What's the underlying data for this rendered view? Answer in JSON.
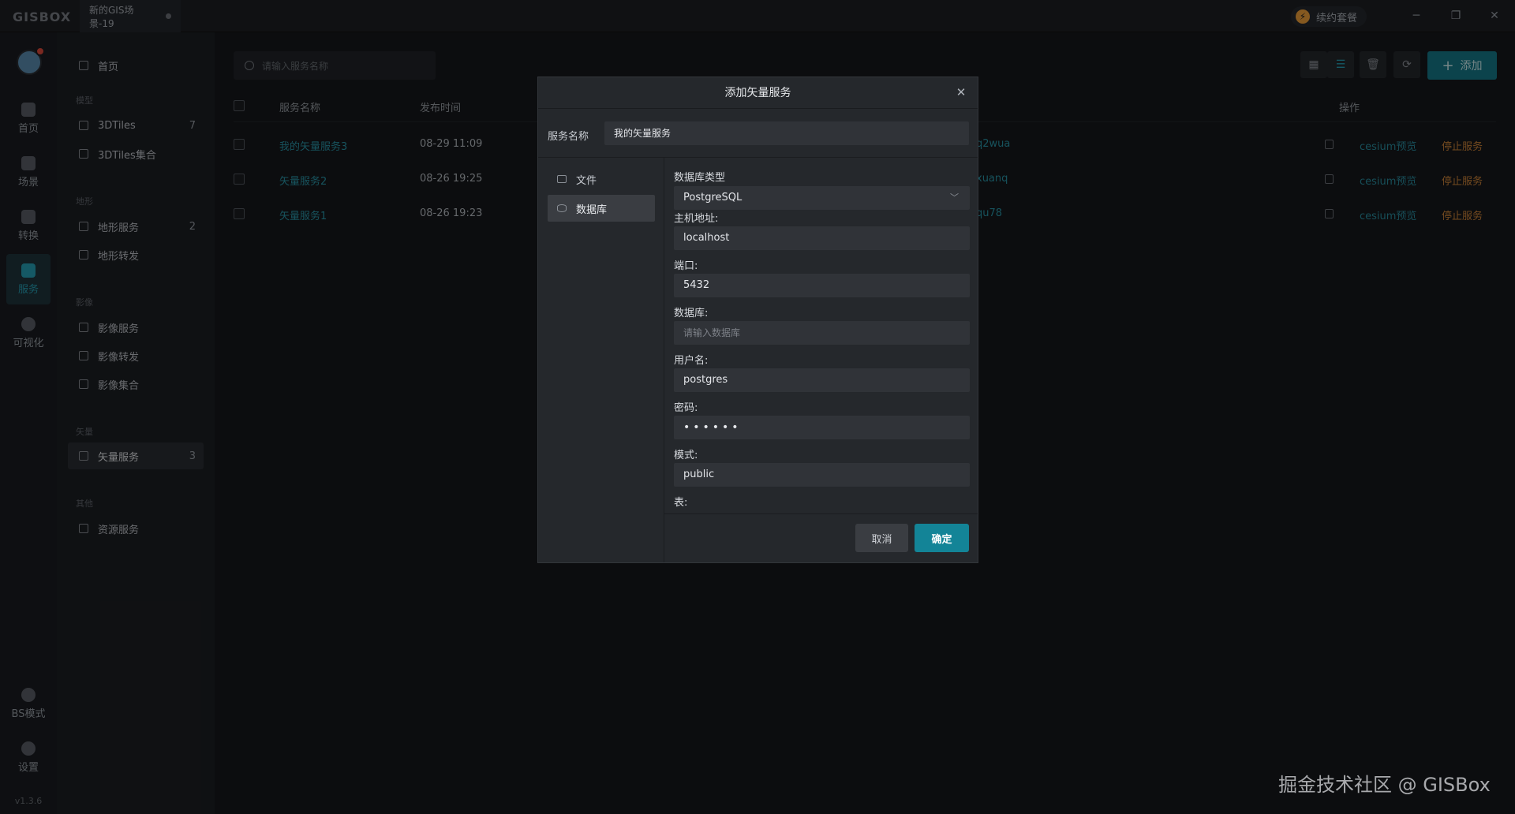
{
  "titlebar": {
    "logo": "GISBOX",
    "doc_tab": "新的GIS场景-19",
    "renew_label": "续约套餐",
    "minimize": "─",
    "restore": "❐",
    "close": "✕"
  },
  "iconbar": {
    "items": [
      {
        "label": "首页"
      },
      {
        "label": "场景"
      },
      {
        "label": "转换"
      },
      {
        "label": "服务"
      },
      {
        "label": "可视化"
      },
      {
        "label": "BS模式"
      },
      {
        "label": "设置"
      }
    ],
    "version": "v1.3.6"
  },
  "sidebar": {
    "home": "首页",
    "groups": {
      "model": "模型",
      "terrain": "地形",
      "imagery": "影像",
      "vector": "矢量",
      "other": "其他"
    },
    "items": {
      "tiles": {
        "label": "3DTiles",
        "count": "7"
      },
      "tiles_set": {
        "label": "3DTiles集合"
      },
      "terrain_service": {
        "label": "地形服务",
        "count": "2"
      },
      "terrain_forward": {
        "label": "地形转发"
      },
      "imagery_service": {
        "label": "影像服务"
      },
      "imagery_forward": {
        "label": "影像转发"
      },
      "imagery_set": {
        "label": "影像集合"
      },
      "vector_service": {
        "label": "矢量服务",
        "count": "3"
      },
      "resource_service": {
        "label": "资源服务"
      }
    }
  },
  "main": {
    "search_placeholder": "请输入服务名称",
    "add_label": "添加",
    "table": {
      "headers": {
        "name": "服务名称",
        "time": "发布时间",
        "ops": "操作"
      },
      "rows": [
        {
          "name": "我的矢量服务3",
          "time": "08-29 11:09",
          "url_tail": "q2wua",
          "preview": "cesium预览",
          "stop": "停止服务"
        },
        {
          "name": "矢量服务2",
          "time": "08-26 19:25",
          "url_tail": "xuanq",
          "preview": "cesium预览",
          "stop": "停止服务"
        },
        {
          "name": "矢量服务1",
          "time": "08-26 19:23",
          "url_tail": "qu78",
          "preview": "cesium预览",
          "stop": "停止服务"
        }
      ]
    }
  },
  "dialog": {
    "title": "添加矢量服务",
    "service_name_label": "服务名称",
    "service_name_value": "我的矢量服务",
    "sources": [
      {
        "label": "文件"
      },
      {
        "label": "数据库"
      }
    ],
    "form": {
      "db_type_label": "数据库类型",
      "db_type_value": "PostgreSQL",
      "host_label": "主机地址:",
      "host_value": "localhost",
      "port_label": "端口:",
      "port_value": "5432",
      "database_label": "数据库:",
      "database_placeholder": "请输入数据库",
      "user_label": "用户名:",
      "user_value": "postgres",
      "password_label": "密码:",
      "password_value": "••••••",
      "schema_label": "模式:",
      "schema_value": "public",
      "table_label": "表:"
    },
    "cancel": "取消",
    "confirm": "确定"
  },
  "watermark": "掘金技术社区 @ GISBox"
}
